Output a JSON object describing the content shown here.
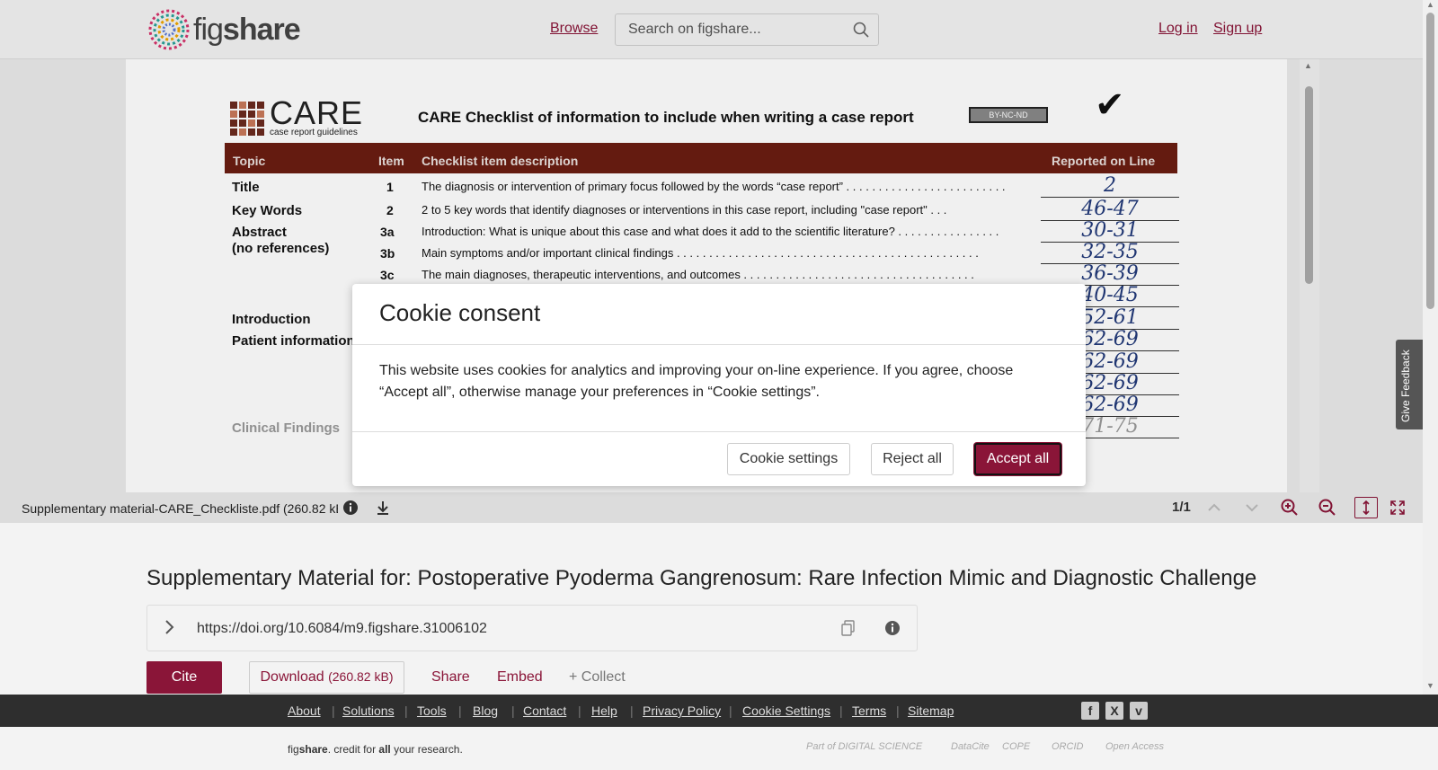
{
  "header": {
    "logo_fig": "fig",
    "logo_share": "share",
    "browse": "Browse",
    "search_placeholder": "Search on figshare...",
    "login": "Log in",
    "signup": "Sign up"
  },
  "document": {
    "care_logo": "CARE",
    "care_sub": "case report guidelines",
    "title": "CARE Checklist of information to include when writing a case report",
    "license": "BY-NC-ND",
    "headers": [
      "Topic",
      "Item",
      "Checklist item description",
      "Reported on Line"
    ],
    "rows": [
      {
        "topic": "Title",
        "item": "1",
        "desc": "The diagnosis or intervention of primary focus followed by the words “case report” . . . . . . . . . . . . . . . . . . . . . . . . .",
        "line": "2"
      },
      {
        "topic": "Key Words",
        "item": "2",
        "desc": "2 to 5 key words that identify diagnoses or interventions in this case report, including \"case report\" . . .",
        "line": "46-47"
      },
      {
        "topic": "Abstract",
        "item": "3a",
        "desc": "Introduction: What is unique about this case and what does it add to the scientific literature? . . . . . . . . . . . . . . . .",
        "line": "30-31"
      },
      {
        "topic": "(no references)",
        "item": "3b",
        "desc": "Main symptoms and/or important clinical findings . . . . . . . . . . . . . . . . . . . . . . . . . . . . . . . . . . . . . . . . . . . . . . .",
        "line": "32-35"
      },
      {
        "topic": "",
        "item": "3c",
        "desc": "The main diagnoses, therapeutic interventions, and outcomes . . . . . . . . . . . . . . . . . . . . . . . . . . . . . . . . . . . .",
        "line": "36-39"
      },
      {
        "topic": "",
        "item": "",
        "desc": "",
        "line": "40-45"
      },
      {
        "topic": "Introduction",
        "item": "",
        "desc": "",
        "line": "52-61"
      },
      {
        "topic": "Patient information",
        "item": "",
        "desc": "",
        "line": "62-69"
      },
      {
        "topic": "",
        "item": "",
        "desc": "",
        "line": "62-69"
      },
      {
        "topic": "",
        "item": "",
        "desc": "",
        "line": "62-69"
      },
      {
        "topic": "",
        "item": "",
        "desc": "",
        "line": "62-69"
      },
      {
        "topic": "Clinical Findings",
        "item": "",
        "desc": "",
        "line": "71-75"
      }
    ]
  },
  "viewer": {
    "filename": "Supplementary material-CARE_Checkliste.pdf",
    "filesize": "(260.82 kB)",
    "pages": "1/1"
  },
  "cookie": {
    "title": "Cookie consent",
    "body": "This website uses cookies for analytics and improving your on-line experience. If you agree, choose “Accept all”, otherwise manage your preferences in “Cookie settings”.",
    "settings": "Cookie settings",
    "reject": "Reject all",
    "accept": "Accept all"
  },
  "feedback": "Give Feedback",
  "article": {
    "title": "Supplementary Material for: Postoperative Pyoderma Gangrenosum: Rare Infection Mimic and Diagnostic Challenge",
    "doi": "https://doi.org/10.6084/m9.figshare.31006102",
    "cite": "Cite",
    "download": "Download",
    "download_size": "(260.82 kB)",
    "share": "Share",
    "embed": "Embed",
    "collect": "+ Collect"
  },
  "footer": {
    "links": [
      "About",
      "Solutions",
      "Tools",
      "Blog",
      "Contact",
      "Help",
      "Privacy Policy",
      "Cookie Settings",
      "Terms",
      "Sitemap"
    ],
    "social": [
      "f",
      "X",
      "v"
    ],
    "tag_fig": "fig",
    "tag_share": "share",
    "tag_mid": ". credit for ",
    "tag_all": "all",
    "tag_end": " your research.",
    "partners": [
      "Part of DIGITAL SCIENCE",
      "DataCite",
      "COPE",
      "ORCID",
      "Open Access"
    ]
  },
  "colors": {
    "accent": "#8a1538",
    "footer_dark": "#2e2e2e",
    "table_header": "#6b1d12",
    "handwriting": "#223a7a"
  }
}
